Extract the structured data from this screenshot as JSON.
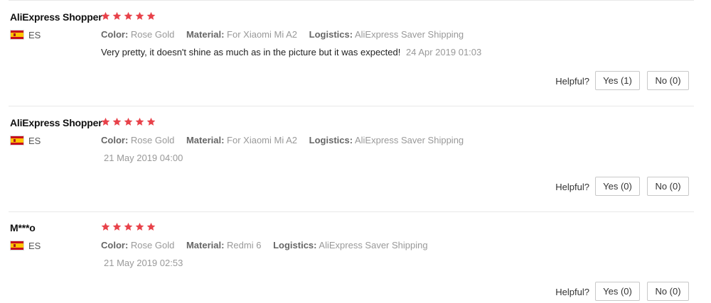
{
  "colors": {
    "star": "#e8424a",
    "label": "#666666",
    "value": "#999999",
    "flag_red": "#c60b1e",
    "flag_yellow": "#ffc400"
  },
  "icons": {
    "star": "star-icon",
    "flag": "spain-flag-icon"
  },
  "labels": {
    "color": "Color:",
    "material": "Material:",
    "logistics": "Logistics:",
    "helpful": "Helpful?"
  },
  "reviews": [
    {
      "name": "AliExpress Shopper",
      "country": "ES",
      "rating": 5,
      "color": "Rose Gold",
      "material": "For Xiaomi Mi A2",
      "logistics": "AliExpress Saver Shipping",
      "text": "Very pretty, it doesn't shine as much as in the picture but it was expected!",
      "date": "24 Apr 2019 01:03",
      "yes_label": "Yes (1)",
      "no_label": "No (0)"
    },
    {
      "name": "AliExpress Shopper",
      "country": "ES",
      "rating": 5,
      "color": "Rose Gold",
      "material": "For Xiaomi Mi A2",
      "logistics": "AliExpress Saver Shipping",
      "text": "",
      "date": "21 May 2019 04:00",
      "yes_label": "Yes (0)",
      "no_label": "No (0)"
    },
    {
      "name": "M***o",
      "country": "ES",
      "rating": 5,
      "color": "Rose Gold",
      "material": "Redmi 6",
      "logistics": "AliExpress Saver Shipping",
      "text": "",
      "date": "21 May 2019 02:53",
      "yes_label": "Yes (0)",
      "no_label": "No (0)"
    }
  ]
}
